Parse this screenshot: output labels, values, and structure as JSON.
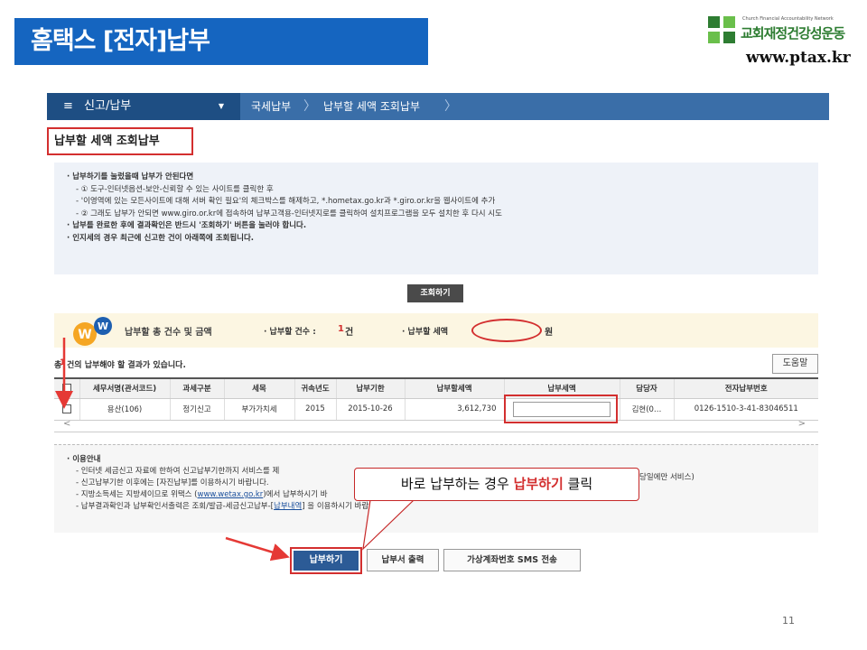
{
  "slide": {
    "title": "홈택스 [전자]납부",
    "page_number": "11"
  },
  "logo": {
    "tiny_text": "Church Financial Accountability Network",
    "org_name": "교회재정건강성운동",
    "url": "www.ptax.kr"
  },
  "nav": {
    "menu_label": "신고/납부",
    "burger_icon": "≡",
    "caret_icon": "▼",
    "breadcrumb": [
      "국세납부",
      "납부할 세액 조회납부"
    ]
  },
  "page": {
    "heading": "납부할 세액 조회납부"
  },
  "notice": {
    "lines": [
      "· 납부하기를 눌렀을때 납부가 안된다면",
      "- ① 도구-인터넷옵션-보안-신뢰할 수 있는 사이트를 클릭한 후",
      "- '이영역에 있는 모든사이트에 대해 서버 확인 필요'의 체크박스를 해제하고, *.hometax.go.kr과 *.giro.or.kr을 웹사이트에 추가",
      "- ② 그래도 납부가 안되면 www.giro.or.kr에 접속하여 납부고객용-인터넷지로를 클릭하여 설치프로그램을 모두 설치한 후 다시 시도",
      "· 납부를 완료한 후에 결과확인은 반드시 '조회하기' 버튼을 눌러야 합니다.",
      "· 인지세의 경우 최근에 신고한 건이 아래쪽에 조회됩니다."
    ]
  },
  "query_button": "조회하기",
  "summary": {
    "title": "납부할 총 건수 및 금액",
    "count_label": "· 납부할 건수 :",
    "count_value": "1",
    "count_unit": "건",
    "amount_label": "· 납부할 세액",
    "amount_unit": "원"
  },
  "results": {
    "prefix": "총",
    "count": "1",
    "text": "건의 납부해야 할 결과가 있습니다.",
    "help_button": "도움말"
  },
  "table": {
    "headers": [
      "",
      "세무서명(관서코드)",
      "과세구분",
      "세목",
      "귀속년도",
      "납부기한",
      "납부할세액",
      "납부세액",
      "담당자",
      "전자납부번호"
    ],
    "rows": [
      {
        "office": "용산(106)",
        "tax_type": "정기신고",
        "tax_item": "부가가치세",
        "year": "2015",
        "due_date": "2015-10-26",
        "amount_due": "3,612,730",
        "payment_amount": "",
        "officer": "김현(0…",
        "e_payment_no": "0126-1510-3-41-83046511"
      }
    ],
    "scroll_left": "<",
    "scroll_right": ">"
  },
  "info": {
    "title": "· 이용안내",
    "lines": [
      "- 인터넷 세금신고 자료에 한하여 신고납부기한까지 서비스를 제",
      "- 신고납부기한 이후에는 [자진납부]를 이용하시기 바랍니다.",
      "- 지방소득세는 지방세이므로 위택스 (",
      "- 납부결과확인과 납부확인서출력은 조회/발급-세금신고납부-["
    ],
    "line3_link": "www.wetax.go.kr",
    "line3_tail": ")에서 납부하시기 바",
    "line4_link": "납부내역",
    "line4_tail": "] 을 이용하시기 바랍니다.",
    "right_fragment": "당일에만 서비스)"
  },
  "callout": {
    "prefix": "바로 납부하는 경우 ",
    "highlight": "납부하기",
    "suffix": " 클릭"
  },
  "buttons": {
    "pay": "납부하기",
    "print": "납부서 출력",
    "sms": "가상계좌번호 SMS 전송"
  },
  "colors": {
    "title_bar": "#1565c0",
    "highlight_red": "#d32f2f",
    "nav_blue": "#3a6ea8",
    "nav_dark": "#1e4e83",
    "pay_button": "#2c5b96",
    "logo_green": "#2e7d32"
  }
}
